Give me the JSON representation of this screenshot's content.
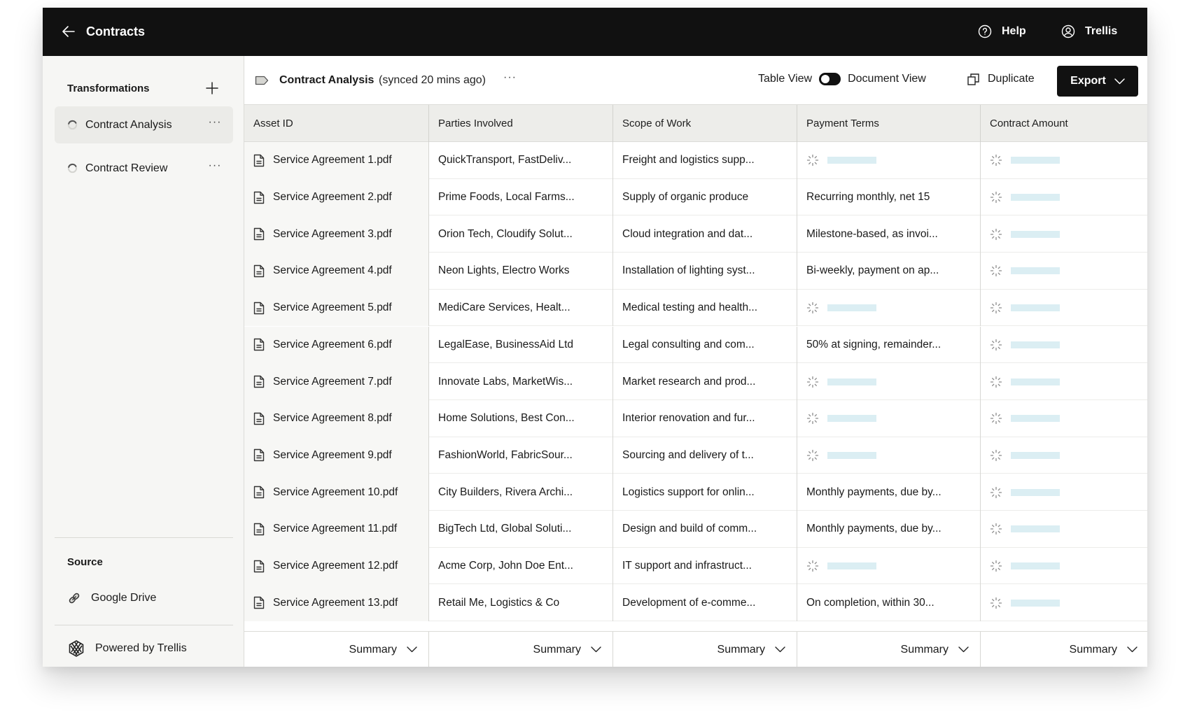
{
  "header": {
    "title": "Contracts",
    "back_icon": "arrow-left-icon",
    "help_label": "Help",
    "help_icon": "help-circle-icon",
    "user_label": "Trellis",
    "user_icon": "user-circle-icon"
  },
  "sidebar": {
    "section_title": "Transformations",
    "add_icon": "plus-icon",
    "items": [
      {
        "label": "Contract Analysis",
        "status_icon": "loading-spinner-icon",
        "active": true
      },
      {
        "label": "Contract Review",
        "status_icon": "loading-spinner-icon",
        "active": false
      }
    ],
    "more_label": "···",
    "source_title": "Source",
    "source_label": "Google Drive",
    "source_icon": "link-icon",
    "powered_label": "Powered by Trellis",
    "powered_icon": "trellis-logo-icon"
  },
  "toolbar": {
    "tag_icon": "tag-icon",
    "name": "Contract Analysis",
    "sync_status": "(synced 20 mins ago)",
    "more_label": "···",
    "view_left": "Table View",
    "view_right": "Document View",
    "view_selected": "Table View",
    "duplicate_label": "Duplicate",
    "duplicate_icon": "copy-icon",
    "export_label": "Export"
  },
  "table": {
    "columns": [
      "Asset ID",
      "Parties Involved",
      "Scope of Work",
      "Payment Terms",
      "Contract Amount"
    ],
    "rows": [
      {
        "asset": "Service Agreement 1.pdf",
        "parties": "QuickTransport, FastDeliv...",
        "scope": "Freight and logistics supp...",
        "payment": null,
        "amount": null
      },
      {
        "asset": "Service Agreement 2.pdf",
        "parties": "Prime Foods, Local Farms...",
        "scope": "Supply of organic produce",
        "payment": "Recurring monthly, net 15",
        "amount": null
      },
      {
        "asset": "Service Agreement 3.pdf",
        "parties": "Orion Tech, Cloudify Solut...",
        "scope": "Cloud integration and dat...",
        "payment": "Milestone-based, as invoi...",
        "amount": null
      },
      {
        "asset": "Service Agreement 4.pdf",
        "parties": "Neon Lights, Electro Works",
        "scope": "Installation of lighting syst...",
        "payment": "Bi-weekly, payment on ap...",
        "amount": null
      },
      {
        "asset": "Service Agreement 5.pdf",
        "parties": "MediCare Services, Healt...",
        "scope": "Medical testing and health...",
        "payment": null,
        "amount": null
      },
      {
        "asset": "Service Agreement 6.pdf",
        "parties": "LegalEase, BusinessAid Ltd",
        "scope": "Legal consulting and com...",
        "payment": "50% at signing, remainder...",
        "amount": null
      },
      {
        "asset": "Service Agreement 7.pdf",
        "parties": "Innovate Labs, MarketWis...",
        "scope": "Market research and prod...",
        "payment": null,
        "amount": null
      },
      {
        "asset": "Service Agreement 8.pdf",
        "parties": "Home Solutions, Best Con...",
        "scope": "Interior renovation and fur...",
        "payment": null,
        "amount": null
      },
      {
        "asset": "Service Agreement 9.pdf",
        "parties": "FashionWorld, FabricSour...",
        "scope": "Sourcing and delivery of t...",
        "payment": null,
        "amount": null
      },
      {
        "asset": "Service Agreement 10.pdf",
        "parties": "City Builders, Rivera Archi...",
        "scope": "Logistics support for onlin...",
        "payment": "Monthly payments, due by...",
        "amount": null
      },
      {
        "asset": "Service Agreement 11.pdf",
        "parties": "BigTech Ltd, Global Soluti...",
        "scope": "Design and build of comm...",
        "payment": "Monthly payments, due by...",
        "amount": null
      },
      {
        "asset": "Service Agreement 12.pdf",
        "parties": "Acme Corp, John Doe Ent...",
        "scope": "IT support and infrastruct...",
        "payment": null,
        "amount": null
      },
      {
        "asset": "Service Agreement 13.pdf",
        "parties": "Retail Me, Logistics & Co",
        "scope": "Development of e-comme...",
        "payment": "On completion, within 30...",
        "amount": null
      }
    ],
    "footer": [
      "Summary",
      "Summary",
      "Summary",
      "Summary",
      "Summary"
    ],
    "loading_color": "#dbeef3"
  }
}
